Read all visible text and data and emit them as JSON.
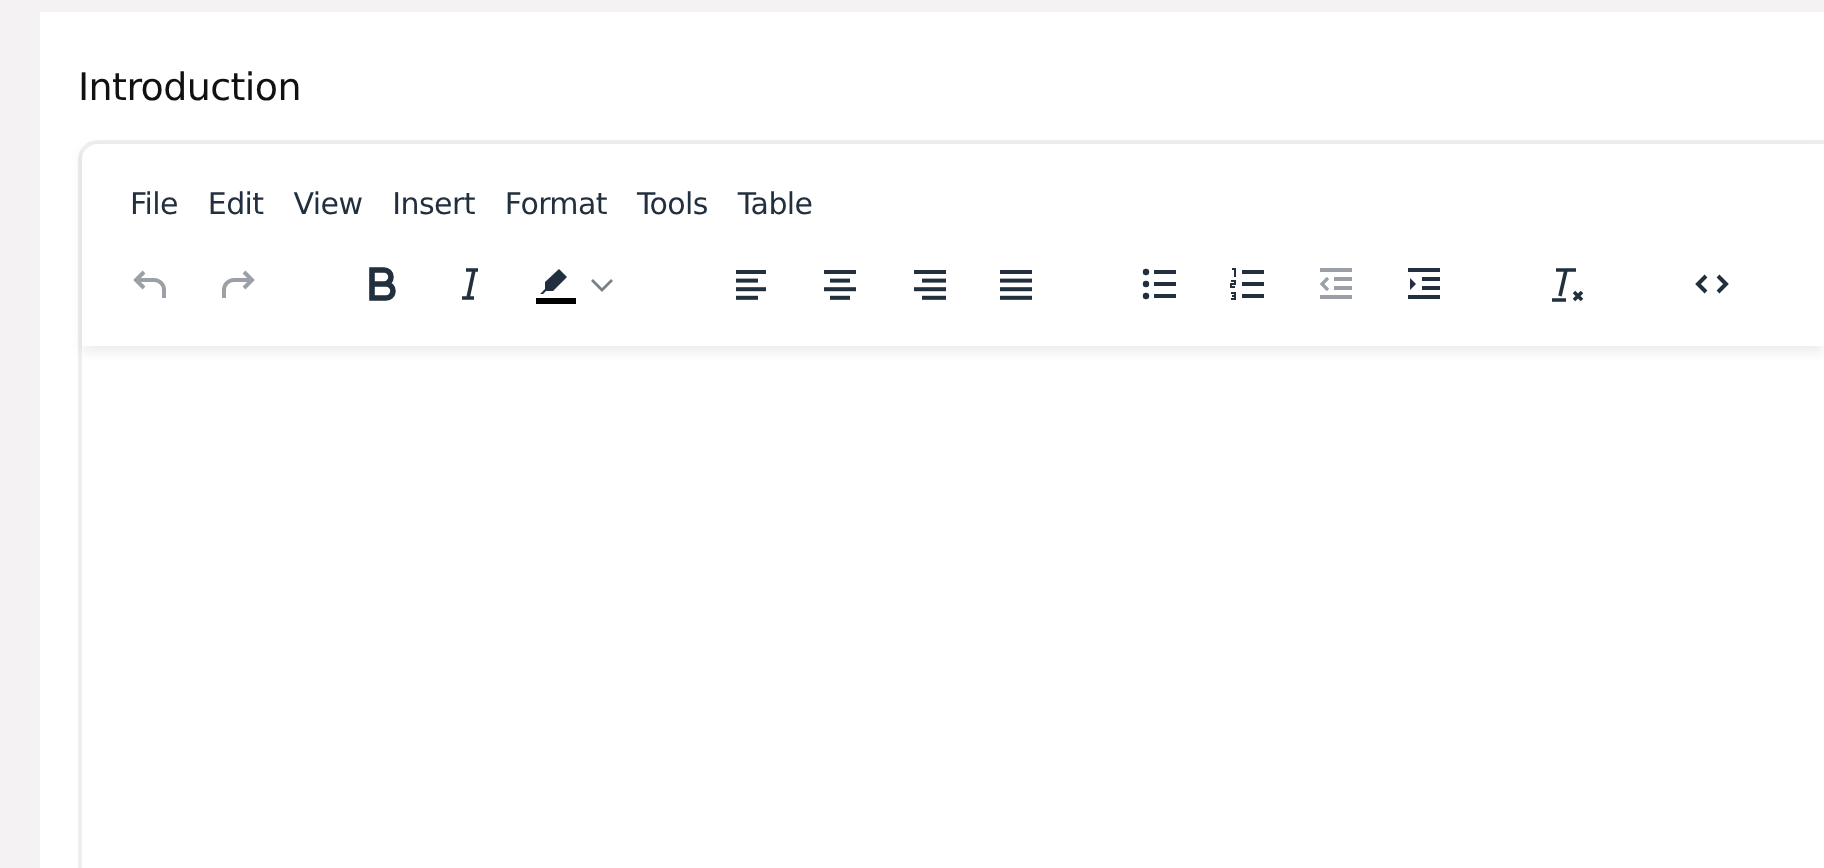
{
  "field": {
    "label": "Introduction"
  },
  "menubar": [
    "File",
    "Edit",
    "View",
    "Insert",
    "Format",
    "Tools",
    "Table"
  ],
  "toolbar": [
    [
      {
        "kind": "undo",
        "disabled": true
      },
      {
        "kind": "redo",
        "disabled": true
      }
    ],
    [
      {
        "kind": "bold",
        "disabled": false
      },
      {
        "kind": "italic",
        "disabled": false
      },
      {
        "kind": "highlight",
        "disabled": false,
        "color": "#000000"
      }
    ],
    [
      {
        "kind": "align-left",
        "disabled": false
      },
      {
        "kind": "align-center",
        "disabled": false
      },
      {
        "kind": "align-right",
        "disabled": false
      },
      {
        "kind": "justify",
        "disabled": false
      }
    ],
    [
      {
        "kind": "bullet-list",
        "disabled": false
      },
      {
        "kind": "numbered-list",
        "disabled": false
      },
      {
        "kind": "outdent",
        "disabled": true
      },
      {
        "kind": "indent",
        "disabled": false
      }
    ],
    [
      {
        "kind": "clear-format",
        "disabled": false
      }
    ],
    [
      {
        "kind": "code",
        "disabled": false
      }
    ]
  ]
}
